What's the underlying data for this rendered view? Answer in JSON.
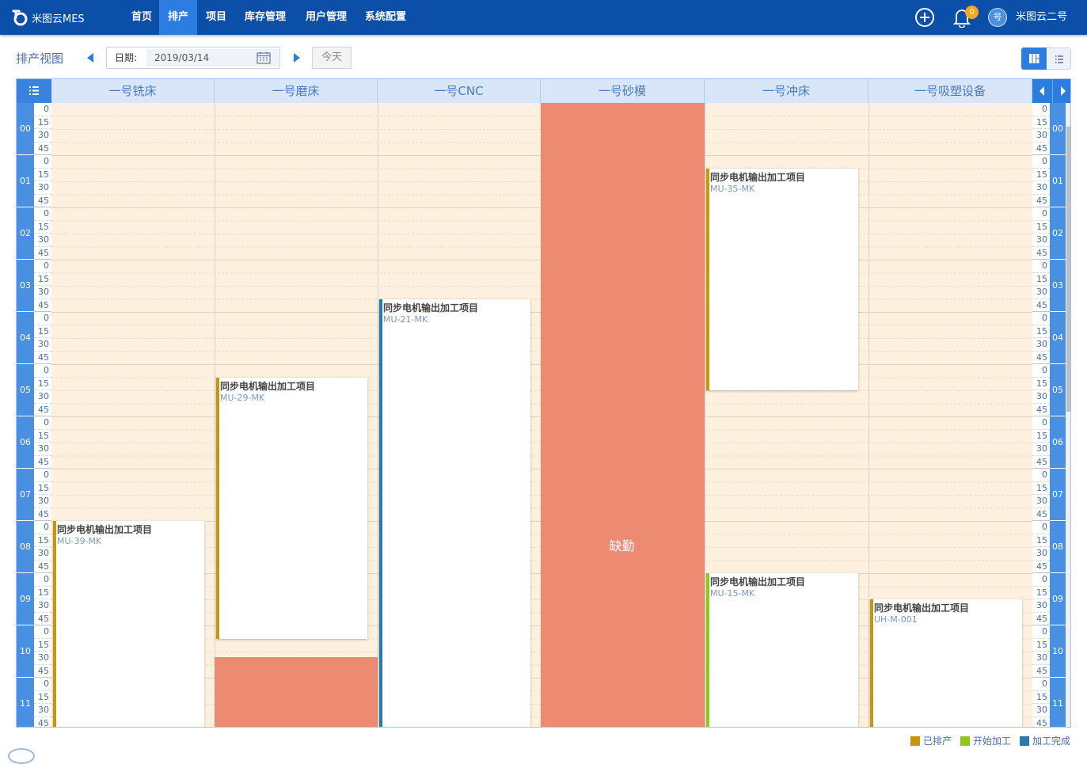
{
  "nav": {
    "brand": "米图云MES",
    "items": [
      {
        "label": "首页",
        "active": false
      },
      {
        "label": "排产",
        "active": true
      },
      {
        "label": "项目",
        "active": false
      },
      {
        "label": "库存管理",
        "active": false
      },
      {
        "label": "用户管理",
        "active": false
      },
      {
        "label": "系统配置",
        "active": false
      }
    ],
    "notification_count": "0",
    "avatar_text": "号",
    "user_name": "米图云二号"
  },
  "toolbar": {
    "title": "排产视图",
    "date_label": "日期:",
    "date_value": "2019/03/14",
    "today_label": "今天"
  },
  "schedule": {
    "columns": [
      "一号铣床",
      "一号磨床",
      "一号CNC",
      "一号砂模",
      "一号冲床",
      "一号吸塑设备"
    ],
    "hours": [
      "00",
      "01",
      "02",
      "03",
      "04",
      "05",
      "06",
      "07",
      "08",
      "09",
      "10",
      "11"
    ],
    "minute_marks": [
      "0",
      "15",
      "30",
      "45"
    ],
    "absence_label": "缺勤",
    "events": [
      {
        "title": "同步电机输出加工项目",
        "code": "MU-39-MK",
        "column": 0,
        "start": 8.0,
        "end": 12.0,
        "status": "已排产"
      },
      {
        "title": "同步电机输出加工项目",
        "code": "MU-29-MK",
        "column": 1,
        "start": 5.25,
        "end": 10.25,
        "status": "已排产"
      },
      {
        "title": "同步电机输出加工项目",
        "code": "MU-21-MK",
        "column": 2,
        "start": 3.75,
        "end": 12.0,
        "status": "加工完成"
      },
      {
        "title": "同步电机输出加工项目",
        "code": "MU-35-MK",
        "column": 4,
        "start": 1.25,
        "end": 5.5,
        "status": "已排产"
      },
      {
        "title": "同步电机输出加工项目",
        "code": "MU-15-MK",
        "column": 4,
        "start": 9.0,
        "end": 12.0,
        "status": "开始加工"
      },
      {
        "title": "同步电机输出加工项目",
        "code": "UH-M-001",
        "column": 5,
        "start": 9.5,
        "end": 12.0,
        "status": "已排产"
      }
    ],
    "absences": [
      {
        "column": 3,
        "start": 0.0,
        "end": 12.0
      },
      {
        "column": 1,
        "start": 10.6,
        "end": 12.0
      }
    ]
  },
  "legend": [
    {
      "label": "已排产",
      "color": "#c8960c"
    },
    {
      "label": "开始加工",
      "color": "#8ec919"
    },
    {
      "label": "加工完成",
      "color": "#2a7ab0"
    }
  ],
  "colors": {
    "nav_bg": "#0b4fa8",
    "accent": "#2b7ee0",
    "absence": "#ec8b72",
    "grid_bg": "#fdf0df"
  }
}
